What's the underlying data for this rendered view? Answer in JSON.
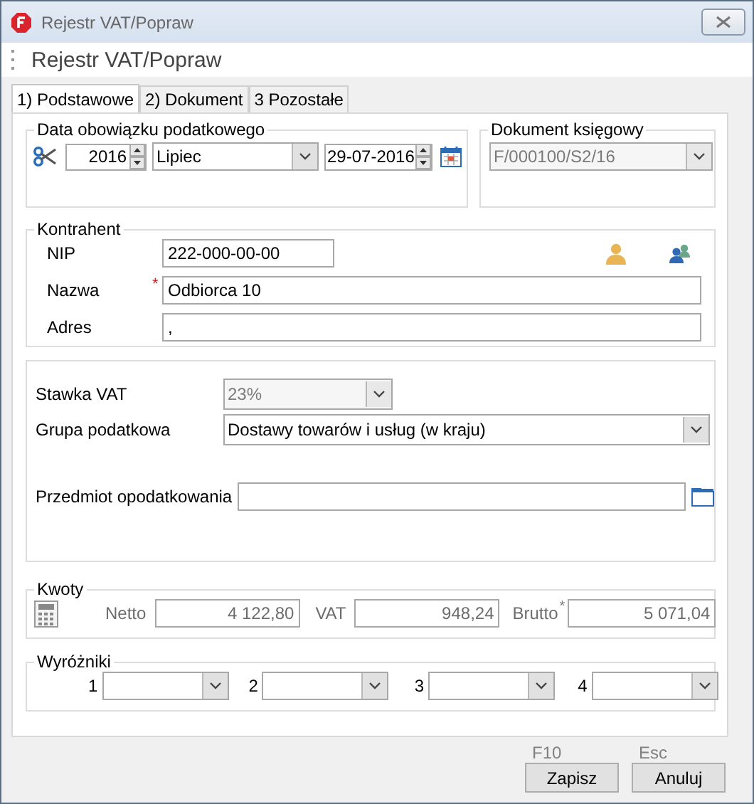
{
  "window": {
    "title": "Rejestr VAT/Popraw",
    "header": "Rejestr VAT/Popraw"
  },
  "tabs": [
    {
      "label": "1) Podstawowe",
      "selected": true
    },
    {
      "label": "2) Dokument",
      "selected": false
    },
    {
      "label": "3 Pozostałe",
      "selected": false
    }
  ],
  "tax_date": {
    "legend": "Data obowiązku podatkowego",
    "year": "2016",
    "month": "Lipiec",
    "date": "29-07-2016"
  },
  "accounting_document": {
    "legend": "Dokument księgowy",
    "value": "F/000100/S2/16",
    "disabled": true
  },
  "contractor": {
    "legend": "Kontrahent",
    "fields": [
      {
        "label": "NIP",
        "value": "222-000-00-00",
        "kind": "short"
      },
      {
        "label": "Nazwa",
        "value": "Odbiorca 10",
        "kind": "wide",
        "required_mark": "*"
      },
      {
        "label": "Adres",
        "value": ",",
        "kind": "wide"
      }
    ]
  },
  "tax": {
    "rate_label": "Stawka VAT",
    "rate": "23%",
    "rate_disabled": true,
    "group_label": "Grupa podatkowa",
    "group": "Dostawy towarów i usług (w kraju)",
    "group_disabled": false,
    "subject_label": "Przedmiot opodatkowania"
  },
  "amounts": {
    "legend": "Kwoty",
    "fields": [
      {
        "label": "Netto",
        "value": "4 122,80",
        "disabled": true
      },
      {
        "label": "VAT",
        "value": "948,24",
        "disabled": true
      },
      {
        "label": "Brutto",
        "value": "5 071,04",
        "disabled": true,
        "required_mark": "*"
      }
    ]
  },
  "markers": {
    "legend": "Wyróżniki",
    "items": [
      {
        "label": "1"
      },
      {
        "label": "2"
      },
      {
        "label": "3"
      },
      {
        "label": "4"
      }
    ]
  },
  "buttons": [
    {
      "label": "Zapisz",
      "shortcut": "F10"
    },
    {
      "label": "Anuluj",
      "shortcut": "Esc"
    }
  ]
}
